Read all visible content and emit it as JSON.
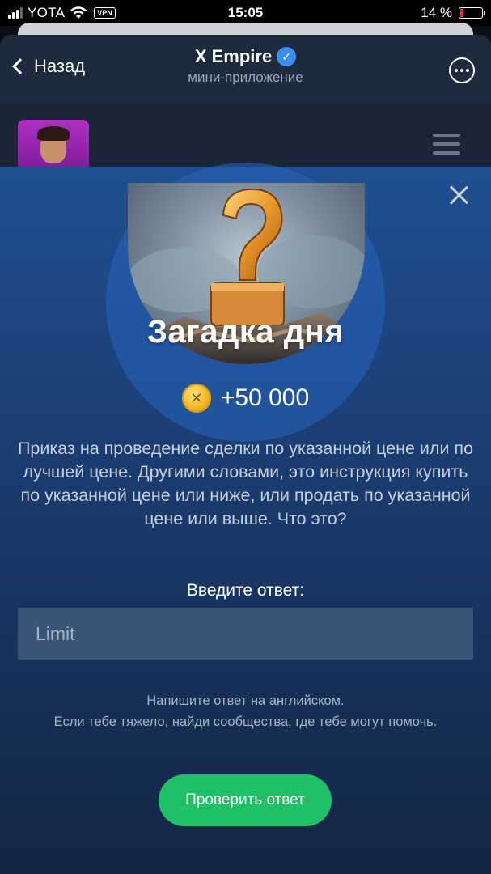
{
  "status_bar": {
    "carrier": "YOTA",
    "vpn": "VPN",
    "time": "15:05",
    "battery": "14 %",
    "battery_level": 0.14
  },
  "header": {
    "back_label": "Назад",
    "title": "X Empire",
    "subtitle": "мини-приложение"
  },
  "riddle": {
    "title": "Загадка дня",
    "reward": "+50 000",
    "question": "Приказ на проведение сделки по указанной цене или по лучшей цене. Другими словами, это инструкция купить по указанной цене или ниже, или продать по указанной цене или выше. Что это?",
    "answer_label": "Введите ответ:",
    "answer_value": "Limit",
    "hint_line1": "Напишите ответ на английском.",
    "hint_line2": "Если тебе тяжело, найди сообщества, где тебе могут помочь.",
    "check_button": "Проверить ответ"
  },
  "colors": {
    "accent_green": "#1fc166",
    "modal_blue": "#1f4f92",
    "verified_blue": "#3a8ef0"
  }
}
